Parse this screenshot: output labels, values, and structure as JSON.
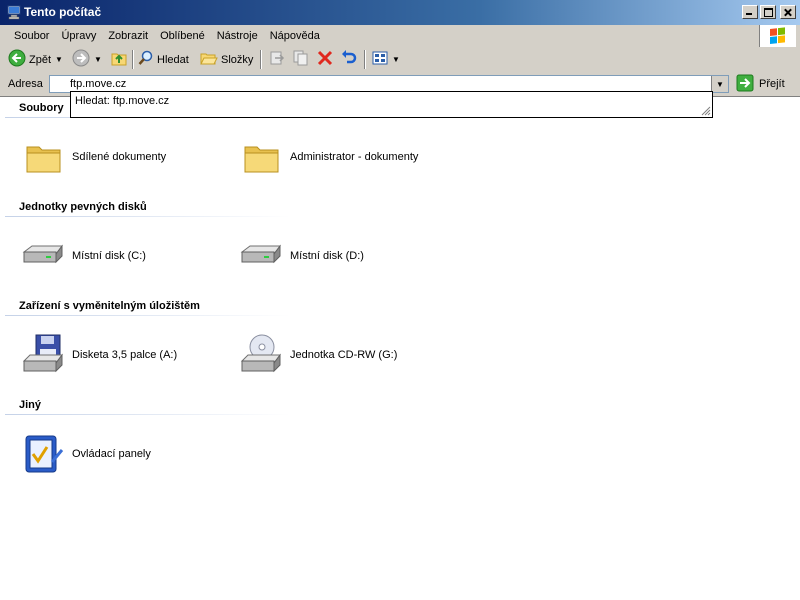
{
  "window": {
    "title": "Tento počítač"
  },
  "menu": [
    {
      "label": "Soubor"
    },
    {
      "label": "Úpravy"
    },
    {
      "label": "Zobrazit"
    },
    {
      "label": "Oblíbené"
    },
    {
      "label": "Nástroje"
    },
    {
      "label": "Nápověda"
    }
  ],
  "toolbar": {
    "back_label": "Zpět",
    "search_label": "Hledat",
    "folders_label": "Složky"
  },
  "address": {
    "label": "Adresa",
    "value": "ftp.move.cz",
    "go_label": "Přejít"
  },
  "autocomplete": {
    "suggestion": "Hledat: ftp.move.cz"
  },
  "groups": [
    {
      "title": "Soubory",
      "items": [
        {
          "name": "Sdílené dokumenty",
          "icon": "folder-icon"
        },
        {
          "name": "Administrator - dokumenty",
          "icon": "folder-icon"
        }
      ]
    },
    {
      "title": "Jednotky pevných disků",
      "items": [
        {
          "name": "Místní disk (C:)",
          "icon": "hard-disk-icon"
        },
        {
          "name": "Místní disk (D:)",
          "icon": "hard-disk-icon"
        }
      ]
    },
    {
      "title": "Zařízení s vyměnitelným úložištěm",
      "items": [
        {
          "name": "Disketa 3,5 palce (A:)",
          "icon": "floppy-drive-icon"
        },
        {
          "name": "Jednotka CD-RW (G:)",
          "icon": "cd-drive-icon"
        }
      ]
    },
    {
      "title": "Jiný",
      "items": [
        {
          "name": "Ovládací panely",
          "icon": "control-panel-icon"
        }
      ]
    }
  ],
  "colors": {
    "titlebar_start": "#0a246a",
    "titlebar_end": "#a6caf0",
    "chrome": "#d4d0c8"
  }
}
